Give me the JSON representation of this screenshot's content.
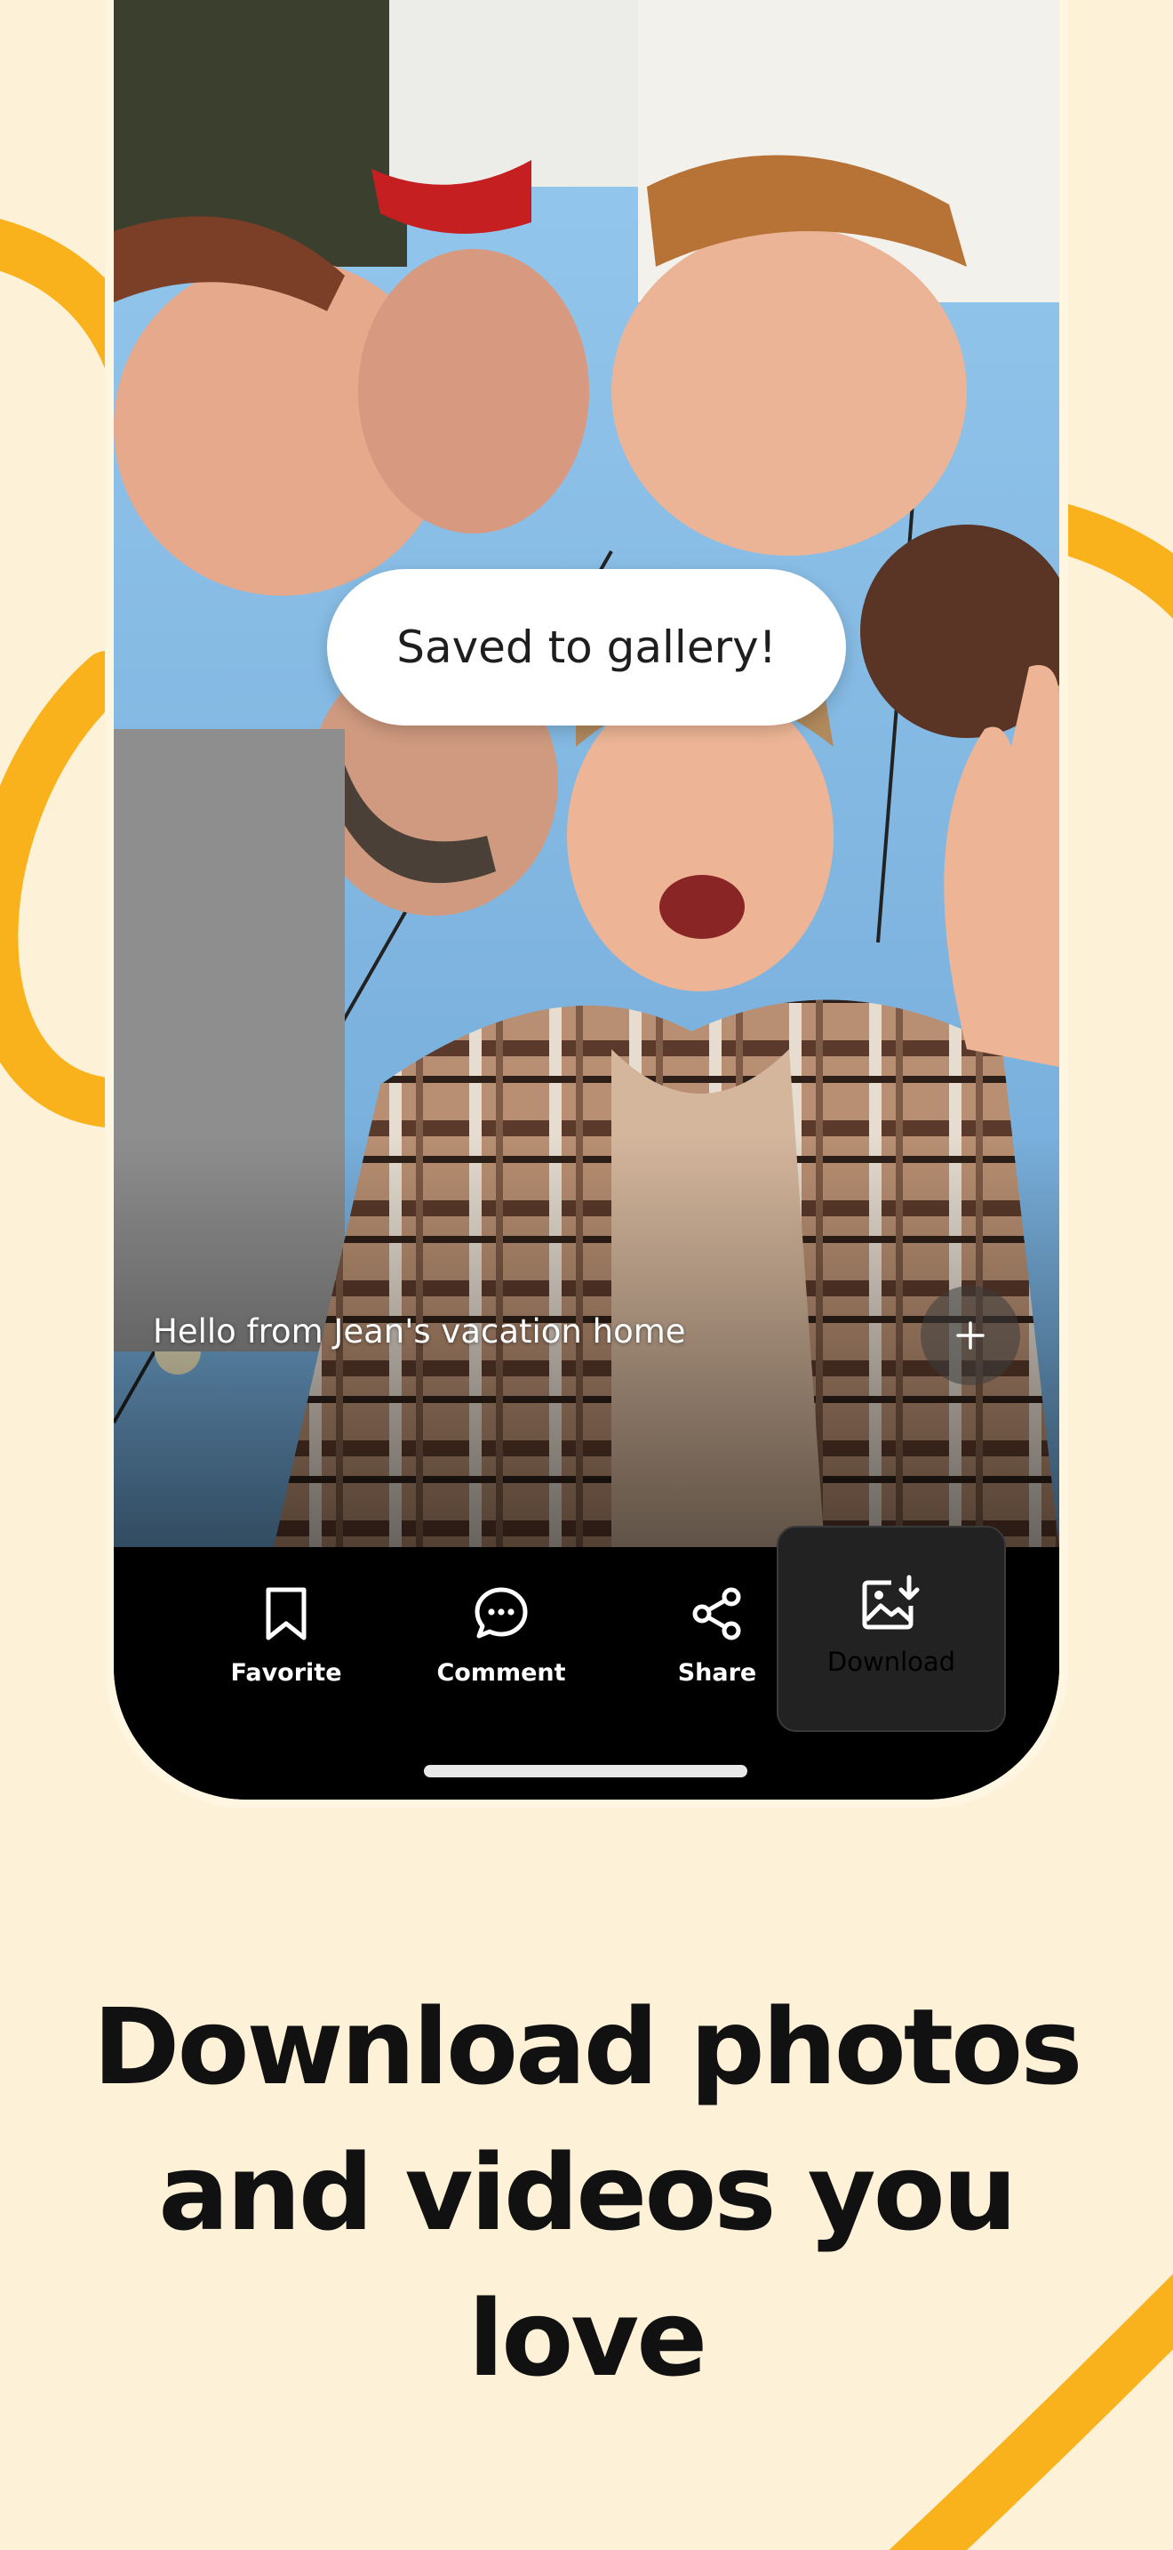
{
  "toast": {
    "text": "Saved to gallery!"
  },
  "photo": {
    "caption": "Hello from Jean's vacation home"
  },
  "plus_button": {
    "icon": "plus-icon"
  },
  "actions": [
    {
      "label": "Favorite",
      "icon": "bookmark-icon"
    },
    {
      "label": "Comment",
      "icon": "chat-bubble-icon"
    },
    {
      "label": "Share",
      "icon": "share-icon"
    },
    {
      "label": "Download",
      "icon": "image-download-icon"
    }
  ],
  "headline": {
    "lines": [
      "Download photos",
      "and videos you",
      "love"
    ]
  },
  "colors": {
    "background": "#FDF1D8",
    "accent_ring": "#F9B21C",
    "phone_body": "#000000",
    "sky": "#8CC3EC"
  }
}
